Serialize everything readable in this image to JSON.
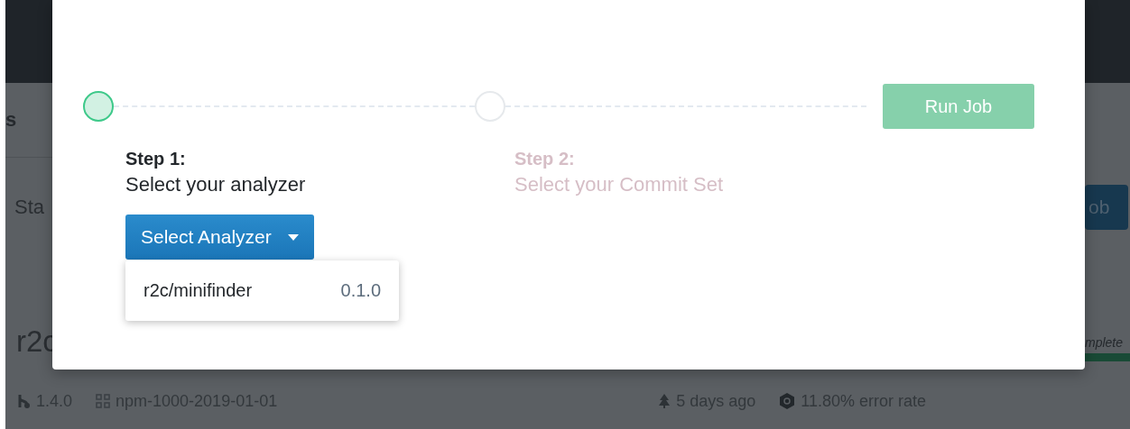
{
  "background": {
    "header_title": "s",
    "toolbar_label": "Sta",
    "project_name": "r2c",
    "action_button": "ob",
    "progress": {
      "label": "mplete",
      "level": 1
    },
    "meta": [
      {
        "kind": "version",
        "text": "1.4.0"
      },
      {
        "kind": "dataset",
        "text": "npm-1000-2019-01-01"
      },
      {
        "kind": "time",
        "text": "5 days ago"
      },
      {
        "kind": "errors",
        "text": "11.80% error rate"
      }
    ]
  },
  "modal": {
    "steps": [
      {
        "title": "Step 1:",
        "subtitle": "Select your analyzer",
        "active": true
      },
      {
        "title": "Step 2:",
        "subtitle": "Select your Commit Set",
        "active": false
      }
    ],
    "run_button": {
      "label": "Run Job",
      "disabled": true
    },
    "dropdown": {
      "label": "Select Analyzer",
      "expanded": true,
      "options": [
        {
          "name": "r2c/minifinder",
          "version": "0.1.0"
        }
      ]
    }
  }
}
